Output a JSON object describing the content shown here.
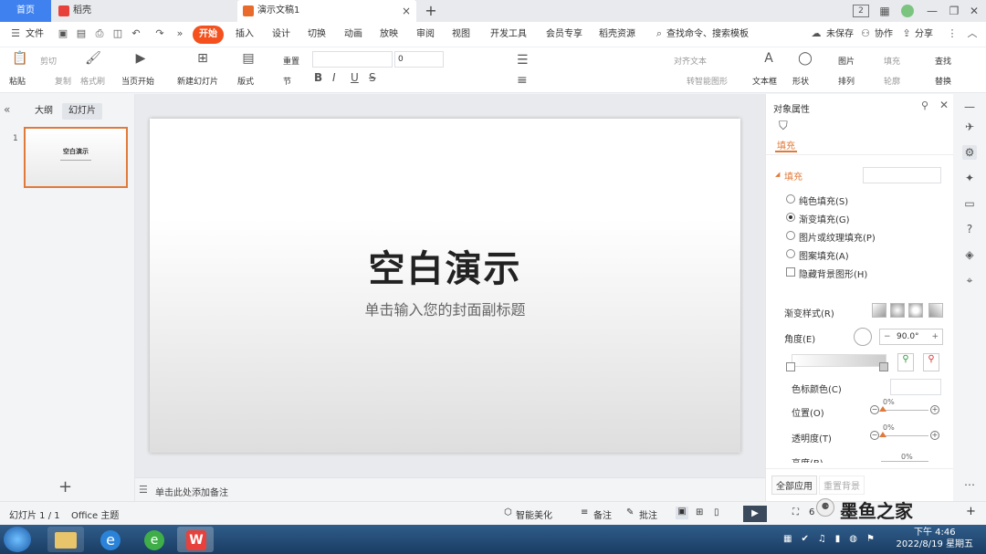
{
  "tabs": {
    "home": "首页",
    "t1": "稻壳",
    "t2": "演示文稿1"
  },
  "menu": {
    "file": "文件",
    "items": [
      "开始",
      "插入",
      "设计",
      "切换",
      "动画",
      "放映",
      "审阅",
      "视图",
      "开发工具",
      "会员专享",
      "稻壳资源"
    ],
    "search": "查找命令、搜索模板",
    "unsaved": "未保存",
    "collab": "协作",
    "share": "分享"
  },
  "ribbon": {
    "paste": "粘贴",
    "cut": "剪切",
    "copy": "复制",
    "format_painter": "格式刷",
    "from_current": "当页开始",
    "new_slide": "新建幻灯片",
    "layout": "版式",
    "section": "节",
    "reset": "重置",
    "font_size": "0",
    "align_text": "对齐文本",
    "smart_graphic": "转智能图形",
    "textbox": "文本框",
    "shape": "形状",
    "picture": "图片",
    "arrange": "排列",
    "fill": "填充",
    "outline": "轮廓",
    "find": "查找",
    "replace": "替换"
  },
  "left_panel": {
    "outline": "大纲",
    "slides": "幻灯片",
    "slide_num": "1",
    "thumb_title": "空白演示"
  },
  "slide": {
    "title": "空白演示",
    "subtitle": "单击输入您的封面副标题"
  },
  "notes": {
    "placeholder": "单击此处添加备注"
  },
  "right_panel": {
    "header": "对象属性",
    "tab_fill": "填充",
    "section_fill": "填充",
    "options": [
      {
        "label": "纯色填充(S)",
        "checked": false
      },
      {
        "label": "渐变填充(G)",
        "checked": true
      },
      {
        "label": "图片或纹理填充(P)",
        "checked": false
      },
      {
        "label": "图案填充(A)",
        "checked": false
      }
    ],
    "hide_bg": "隐藏背景图形(H)",
    "gradient_style": "渐变样式(R)",
    "angle_label": "角度(E)",
    "angle_value": "90.0°",
    "stop_color": "色标颜色(C)",
    "position": "位置(O)",
    "position_value": "0%",
    "transparency": "透明度(T)",
    "transparency_value": "0%",
    "brightness": "亮度(B)",
    "brightness_value": "0%",
    "apply_all": "全部应用",
    "reset_bg": "重置背景"
  },
  "status": {
    "slide_info": "幻灯片 1 / 1",
    "theme": "Office 主题",
    "beautify": "智能美化",
    "notes": "备注",
    "comments": "批注",
    "zoom": "6"
  },
  "taskbar": {
    "time": "下午 4:46",
    "date": "2022/8/19 星期五"
  },
  "watermark": {
    "text": "墨鱼之家"
  },
  "colors": {
    "accent": "#f4511e",
    "home_tab": "#3f82ef",
    "selection": "#e07a3a"
  }
}
